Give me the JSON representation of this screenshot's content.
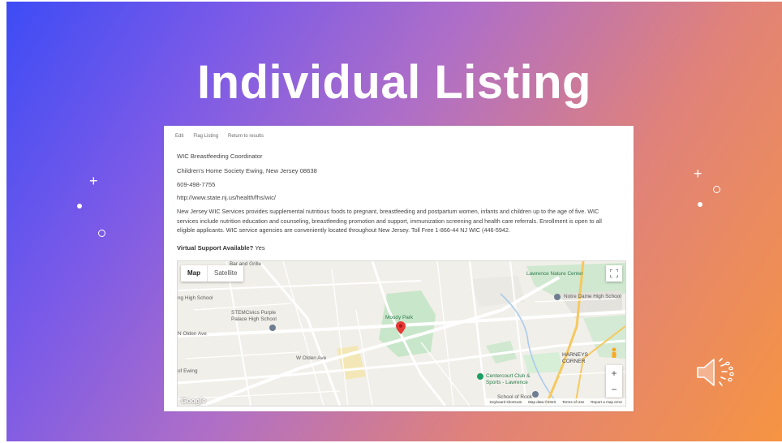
{
  "slide": {
    "title": "Individual Listing"
  },
  "listing": {
    "links": [
      "Edit",
      "Flag Listing",
      "Return to results"
    ],
    "name": "WIC Breastfeeding Coordinator",
    "address": "Children's Home Society  Ewing, New Jersey 08638",
    "phone": "609-498-7755",
    "url": "http://www.state.nj.us/health/fhs/wic/",
    "description": "New Jersey WIC Services provides supplemental nutritious foods to pregnant, breastfeeding and postpartum women, infants and children up to the age of five. WIC services include nutrition education and counseling, breastfeeding promotion and support, immunization screening and health care referrals. Enrollment is open to all eligible applicants. WIC service agencies are conveniently located throughout New Jersey. Toll Free 1-866-44 NJ WIC (446-5942.",
    "virtual_support_label": "Virtual Support Available?",
    "virtual_support_value": "Yes"
  },
  "map": {
    "type_map": "Map",
    "type_satellite": "Satellite",
    "zoom_in": "+",
    "zoom_out": "−",
    "labels": {
      "bar_grille": "Bar and Grille",
      "high_school": "ng High School",
      "stemcivics": "STEMCivics Purple\nPalace High School",
      "olden_ave": "N Olden Ave",
      "moody_park": "Moody Park",
      "lawrence_nature": "Lawrence Nature Center",
      "notre_dame": "Notre Dame High School",
      "harneys": "HARNEYS\nCORNER",
      "centercourt": "Centercourt Club &\nSports - Lawrence",
      "school_of_rock": "School of Rock",
      "of_ewing": "of Ewing",
      "w_olden": "W Olden Ave"
    },
    "footer": {
      "shortcuts": "Keyboard shortcuts",
      "mapdata": "Map data ©2023",
      "terms": "Terms of Use",
      "report": "Report a map error"
    },
    "logo": "Google"
  },
  "colors": {
    "pin": "#e53935",
    "park": "#c8e6c9"
  },
  "icons": {
    "speaker": "speaker-icon",
    "fullscreen": "fullscreen-icon",
    "pin": "map-pin-icon",
    "pegman": "pegman-icon"
  }
}
